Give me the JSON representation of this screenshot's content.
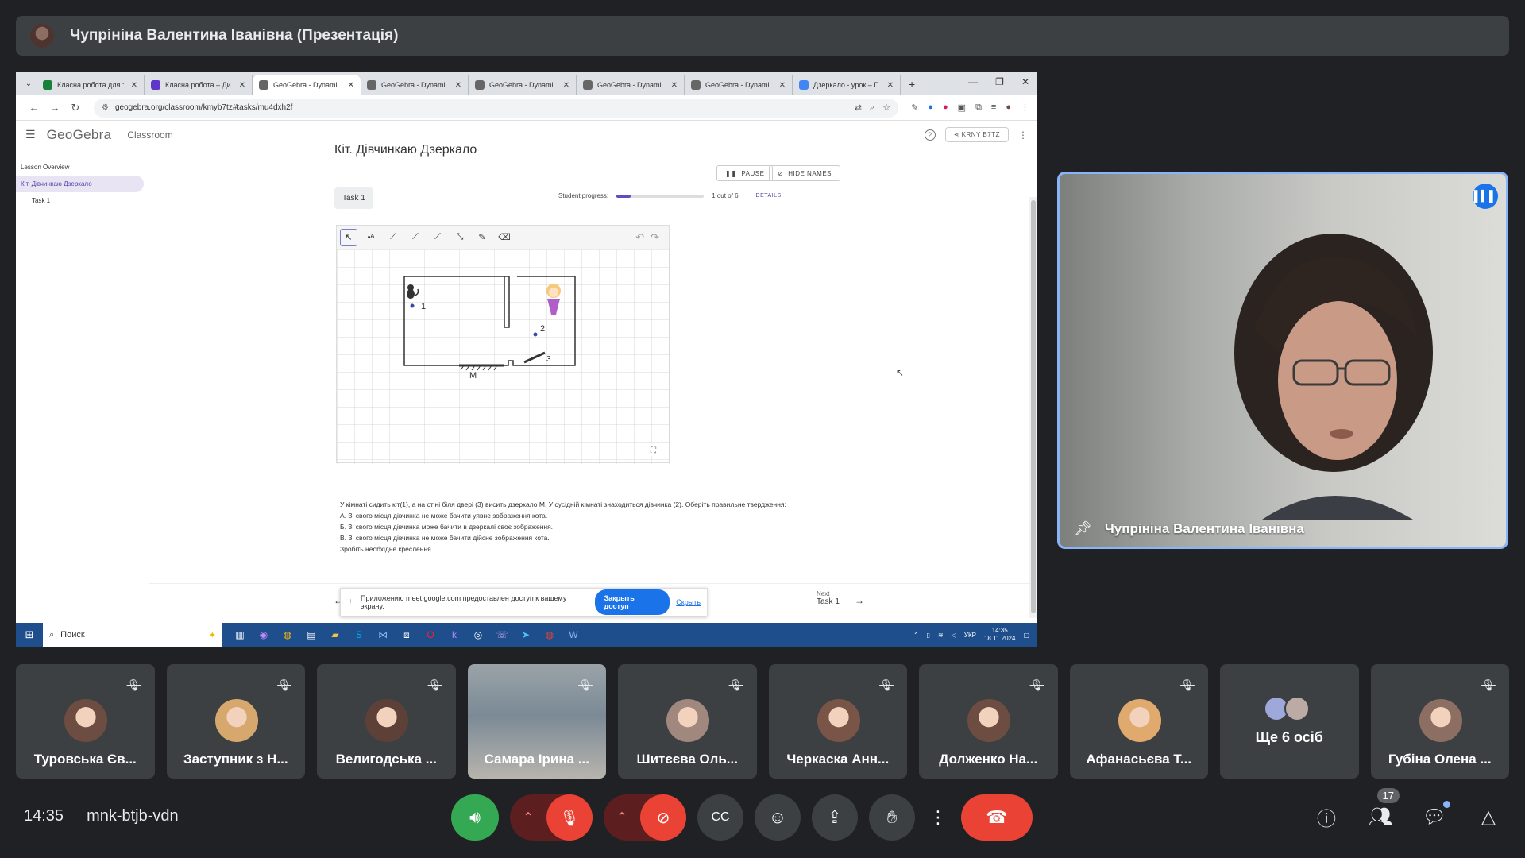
{
  "presenter": {
    "title": "Чупрініна Валентина Іванівна (Презентація)"
  },
  "browser": {
    "tabs": [
      {
        "label": "Класна робота для :",
        "color": "#188038"
      },
      {
        "label": "Класна робота – Ди",
        "color": "#5f36c9"
      },
      {
        "label": "GeoGebra - Dynami",
        "color": "#666666",
        "active": true
      },
      {
        "label": "GeoGebra - Dynami",
        "color": "#666666"
      },
      {
        "label": "GeoGebra - Dynami",
        "color": "#666666"
      },
      {
        "label": "GeoGebra - Dynami",
        "color": "#666666"
      },
      {
        "label": "GeoGebra - Dynami",
        "color": "#666666"
      },
      {
        "label": "Дзеркало - урок – Г",
        "color": "#4285f4"
      }
    ],
    "url": "geogebra.org/classroom/kmyb7tz#tasks/mu4dxh2f"
  },
  "geogebra": {
    "logo": "GeoGebra",
    "section": "Classroom",
    "class_code": "KRNY B7TZ",
    "sidebar": {
      "overview": "Lesson Overview",
      "lesson": "Кіт. Дівчинкаю Дзеркало",
      "task": "Task 1"
    },
    "lesson_title": "Кіт. Дівчинкаю Дзеркало",
    "pause_label": "PAUSE",
    "hide_names_label": "HIDE NAMES",
    "task_chip": "Task 1",
    "progress": {
      "label": "Student progress:",
      "value": 1,
      "total": 6,
      "text": "1 out of 6",
      "details": "DETAILS"
    },
    "figure_labels": {
      "p1": "1",
      "p2": "2",
      "p3": "3",
      "mirror": "M"
    },
    "problem": [
      "У кімнаті сидить кіт(1), а на стіні біля двері (3) висить дзеркало М. У сусідній кімнаті знаходиться дівчинка (2). Оберіть правильне твердження:",
      "А. Зі свого місця дівчинка не може бачити уявне зображення кота.",
      "Б. Зі свого місця дівчинка може бачити в дзеркалі своє зображення.",
      "В. Зі свого місця дівчинка не може бачити дійсне зображення кота.",
      "Зробіть необхідне креслення."
    ],
    "next_label": "Next",
    "next_task": "Task 1"
  },
  "share_notice": {
    "text": "Приложению meet.google.com предоставлен доступ к вашему экрану.",
    "stop": "Закрыть доступ",
    "hide": "Скрыть"
  },
  "taskbar": {
    "search": "Поиск",
    "lang": "УКР",
    "time": "14:35",
    "date": "18.11.2024"
  },
  "pinned": {
    "name": "Чупрініна Валентина Іванівна"
  },
  "participants": [
    {
      "name": "Туровська Єв...",
      "color": "#6d4c41"
    },
    {
      "name": "Заступник з Н...",
      "color": "#d7a86e"
    },
    {
      "name": "Велигодська ...",
      "color": "#5d4037"
    },
    {
      "name": "Самара Ірина ...",
      "color": "#8d9aa5",
      "video": true
    },
    {
      "name": "Шитєєва Оль...",
      "color": "#a1887f"
    },
    {
      "name": "Черкаска Анн...",
      "color": "#795548"
    },
    {
      "name": "Долженко На...",
      "color": "#6d4c41"
    },
    {
      "name": "Афанасьєва Т...",
      "color": "#e0a96d"
    },
    {
      "name": "Ще 6 осіб",
      "more": true
    },
    {
      "name": "Губіна Олена ...",
      "color": "#8d6e63"
    }
  ],
  "meeting": {
    "time": "14:35",
    "code": "mnk-btjb-vdn",
    "participant_count": "17"
  }
}
